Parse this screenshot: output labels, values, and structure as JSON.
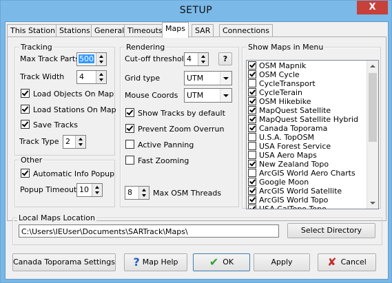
{
  "window": {
    "title": "SETUP",
    "close_glyph": "X"
  },
  "tabs": [
    {
      "label": "This Station"
    },
    {
      "label": "Stations"
    },
    {
      "label": "General"
    },
    {
      "label": "Timeouts"
    },
    {
      "label": "Maps",
      "active": true
    },
    {
      "label": "SAR"
    },
    {
      "label": "Connections"
    }
  ],
  "tracking": {
    "title": "Tracking",
    "max_track_parts_label": "Max Track Parts",
    "max_track_parts_value": "500",
    "track_width_label": "Track Width",
    "track_width_value": "4",
    "load_objects_label": "Load Objects On Map",
    "load_objects_checked": true,
    "load_stations_label": "Load Stations On Map",
    "load_stations_checked": true,
    "save_tracks_label": "Save Tracks",
    "save_tracks_checked": true,
    "track_type_label": "Track Type",
    "track_type_value": "2"
  },
  "other": {
    "title": "Other",
    "auto_popup_label": "Automatic Info Popup",
    "auto_popup_checked": true,
    "popup_timeout_label": "Popup Timeout",
    "popup_timeout_value": "10"
  },
  "rendering": {
    "title": "Rendering",
    "cutoff_label": "Cut-off threshold",
    "cutoff_value": "4",
    "help_label": "?",
    "grid_type_label": "Grid type",
    "grid_type_value": "UTM",
    "mouse_coords_label": "Mouse Coords",
    "mouse_coords_value": "UTM",
    "show_tracks_label": "Show Tracks by default",
    "show_tracks_checked": true,
    "prevent_zoom_label": "Prevent Zoom Overrun",
    "prevent_zoom_checked": true,
    "active_panning_label": "Active Panning",
    "active_panning_checked": false,
    "fast_zooming_label": "Fast Zooming",
    "fast_zooming_checked": false,
    "max_threads_value": "8",
    "max_threads_label": "Max OSM Threads"
  },
  "show_maps": {
    "title": "Show Maps in Menu",
    "items": [
      {
        "label": "OSM Mapnik",
        "checked": true
      },
      {
        "label": "OSM Cycle",
        "checked": true
      },
      {
        "label": "CycleTransport",
        "checked": false
      },
      {
        "label": "CycleTerain",
        "checked": true
      },
      {
        "label": "OSM Hikebike",
        "checked": true
      },
      {
        "label": "MapQuest Satellite",
        "checked": true
      },
      {
        "label": "MapQuest Satellite Hybrid",
        "checked": true
      },
      {
        "label": "Canada Toporama",
        "checked": true
      },
      {
        "label": "U.S.A. TopOSM",
        "checked": false
      },
      {
        "label": "USA Forest Service",
        "checked": false
      },
      {
        "label": "USA Aero Maps",
        "checked": false
      },
      {
        "label": "New Zealand Topo",
        "checked": true
      },
      {
        "label": "ArcGIS World Aero Charts",
        "checked": false
      },
      {
        "label": "Google Moon",
        "checked": true
      },
      {
        "label": "ArcGIS World Satellite",
        "checked": true
      },
      {
        "label": "ArcGIS World Topo",
        "checked": true
      },
      {
        "label": "USA CalTopo Topo",
        "checked": true
      }
    ]
  },
  "local_maps": {
    "title": "Local Maps Location",
    "path": "C:\\Users\\IEUser\\Documents\\SARTrack\\Maps\\",
    "select_label": "Select Directory"
  },
  "footer": {
    "canada_label": "Canada Toporama Settings",
    "map_help_label": "Map Help",
    "ok_label": "OK",
    "apply_label": "Apply",
    "cancel_label": "Cancel"
  },
  "colors": {
    "titlebar": "#7ab9e8",
    "close": "#c7403a",
    "ok_check": "#2e9e2e",
    "cancel_x": "#c62828",
    "selection": "#3399ff"
  }
}
